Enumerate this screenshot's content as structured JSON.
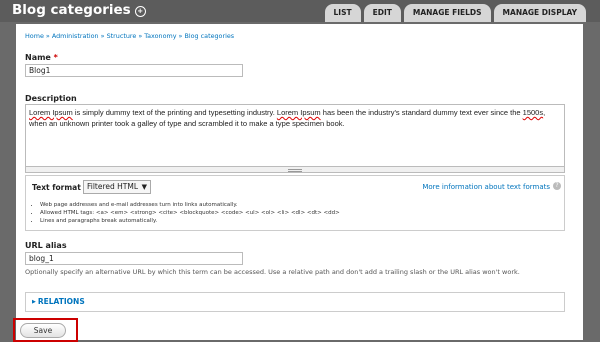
{
  "header": {
    "title": "Blog categories",
    "shortcut_icon": "star-circle-icon",
    "tabs": [
      "LIST",
      "EDIT",
      "MANAGE FIELDS",
      "MANAGE DISPLAY"
    ]
  },
  "breadcrumb": "Home » Administration » Structure » Taxonomy » Blog categories",
  "name_field": {
    "label": "Name",
    "required_marker": "*",
    "value": "Blog1"
  },
  "description": {
    "label": "Description",
    "segments": [
      {
        "text": "Lorem Ipsum",
        "spell": true
      },
      {
        "text": " is simply dummy text of the printing and typesetting industry. ",
        "spell": false
      },
      {
        "text": "Lorem Ipsum",
        "spell": true
      },
      {
        "text": " has been the industry's standard dummy text ever since the ",
        "spell": false
      },
      {
        "text": "1500s",
        "spell": true
      },
      {
        "text": ", when an unknown printer took a galley of type and scrambled it to make a type specimen book.",
        "spell": false
      }
    ]
  },
  "text_format": {
    "label": "Text format",
    "selected": "Filtered HTML",
    "more_link": "More information about text formats",
    "tips": [
      "Web page addresses and e-mail addresses turn into links automatically.",
      "Allowed HTML tags: <a> <em> <strong> <cite> <blockquote> <code> <ul> <ol> <li> <dl> <dt> <dd>",
      "Lines and paragraphs break automatically."
    ]
  },
  "url_alias": {
    "label": "URL alias",
    "value": "blog_1",
    "hint": "Optionally specify an alternative URL by which this term can be accessed. Use a relative path and don't add a trailing slash or the URL alias won't work."
  },
  "relations": {
    "label": "RELATIONS"
  },
  "actions": {
    "save_label": "Save"
  },
  "colors": {
    "link": "#0074bd",
    "highlight": "#cc0000",
    "required": "#cc0000"
  }
}
